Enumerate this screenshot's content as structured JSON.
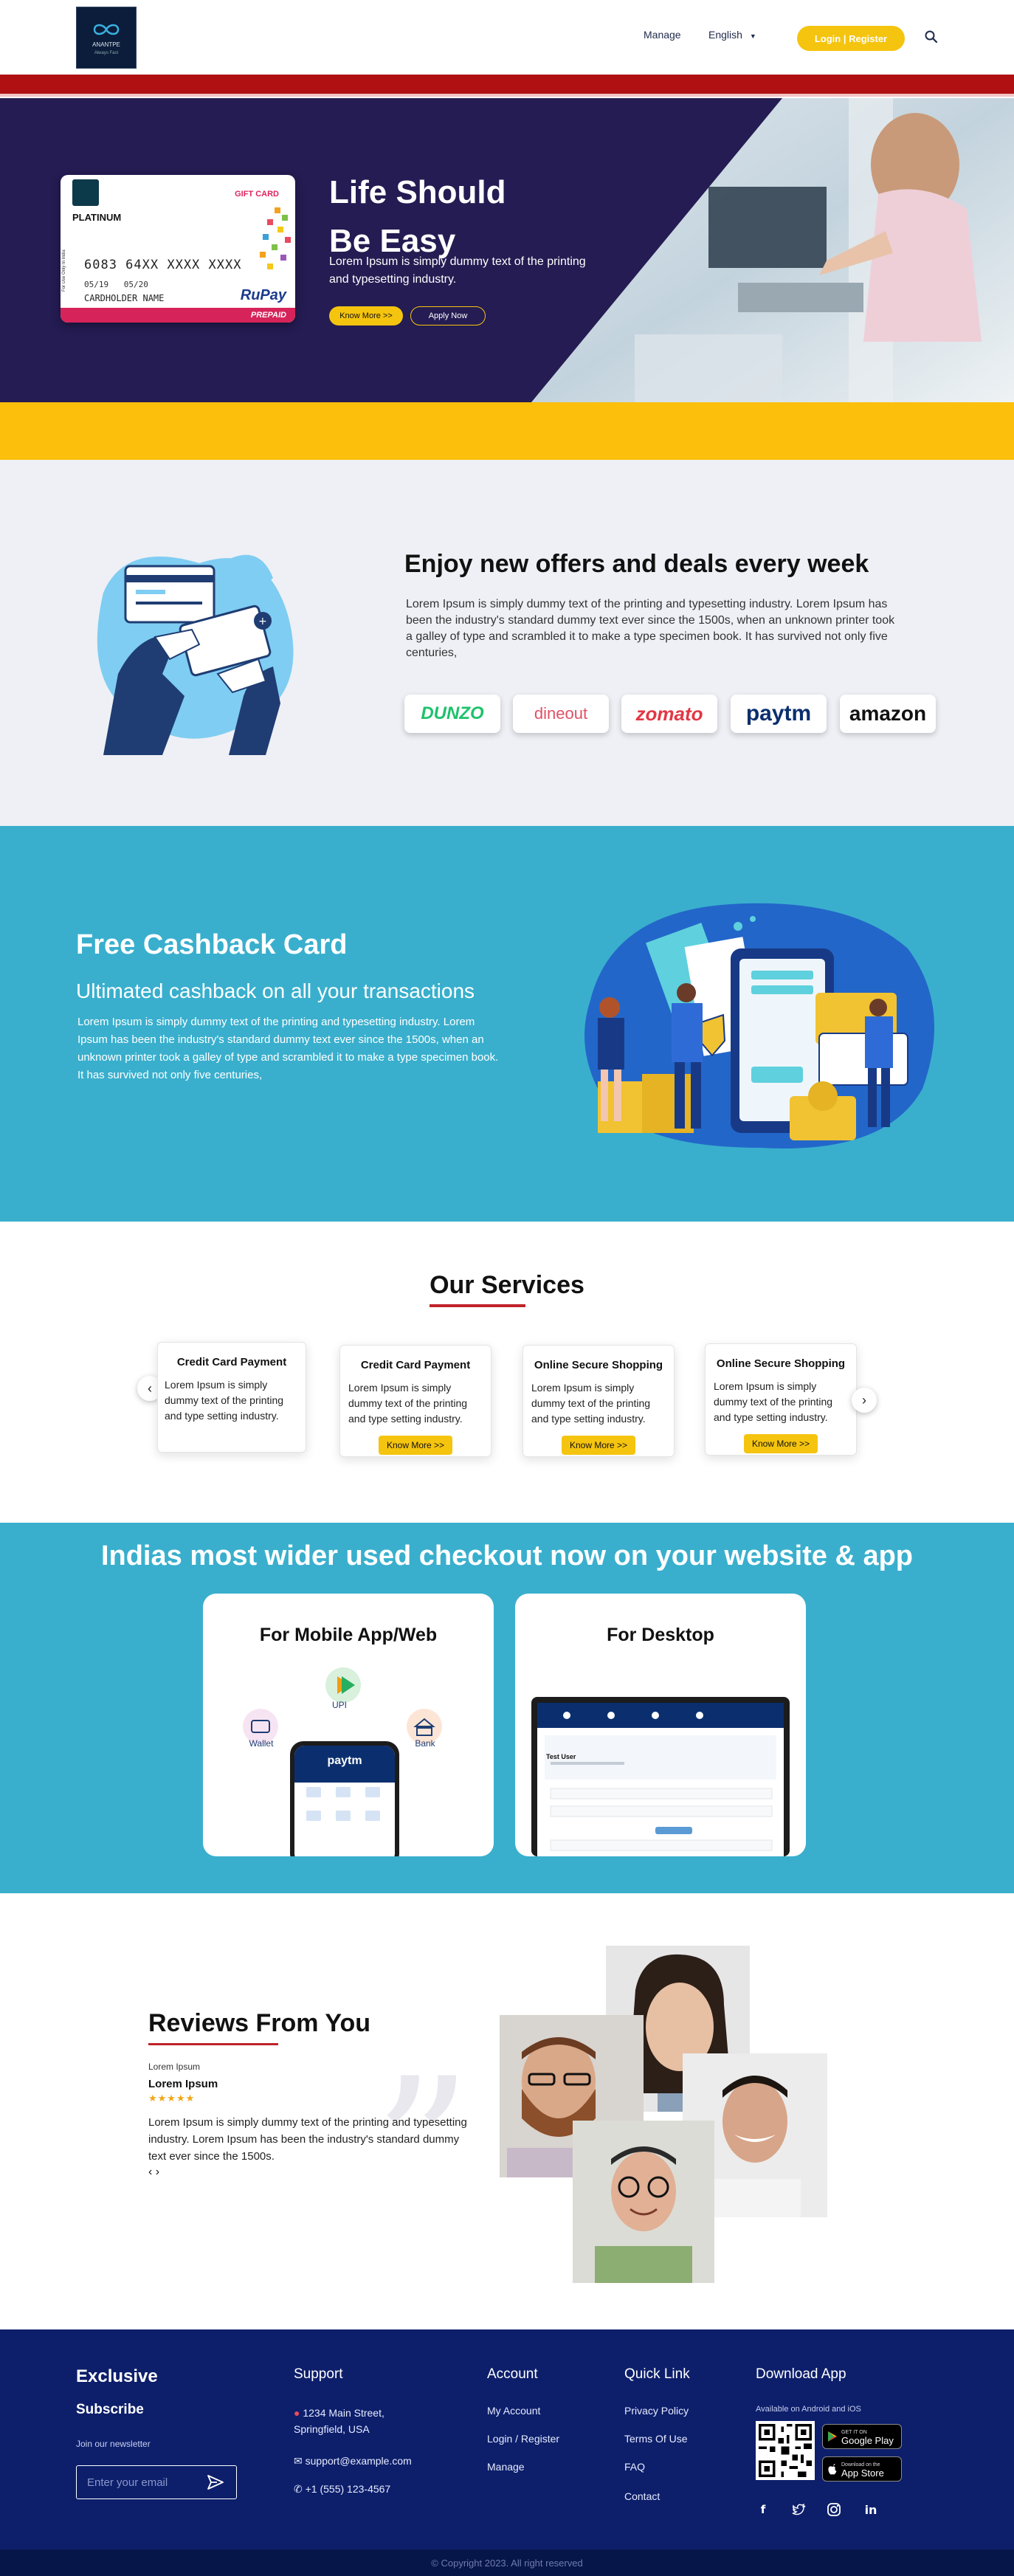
{
  "header": {
    "logo_text": "ANANTPE",
    "logo_tagline": "Always Fast",
    "nav": {
      "manage": "Manage",
      "language": "English"
    },
    "login_label": "Login | Register"
  },
  "hero": {
    "title_line1": "Life Should",
    "title_line2": "Be Easy",
    "description": "Lorem Ipsum is simply dummy text of the printing and typesetting industry.",
    "know_more": "Know More >>",
    "apply_now": "Apply Now",
    "card": {
      "tier": "PLATINUM",
      "gift": "GIFT CARD",
      "number": "6083 64XX XXXX XXXX",
      "valid_from": "05/19",
      "valid_thru": "05/20",
      "holder": "CARDHOLDER NAME",
      "network": "RuPay",
      "prepaid": "PREPAID",
      "side_text": "For Use Only In India"
    }
  },
  "offers": {
    "title": "Enjoy new offers and deals every week",
    "text": "Lorem Ipsum is simply dummy text of the printing and typesetting industry. Lorem Ipsum has been the industry's standard dummy text ever since the 1500s, when an unknown printer took a galley of type and scrambled it to make a type specimen book. It has survived not only five centuries,",
    "brands": [
      "DUNZO",
      "dineout",
      "zomato",
      "paytm",
      "amazon"
    ]
  },
  "cashback": {
    "title": "Free Cashback Card",
    "subtitle": "Ultimated cashback on all your transactions",
    "text": "Lorem Ipsum is simply dummy text of the printing and typesetting industry. Lorem Ipsum has been the industry's standard dummy text ever since the 1500s, when an unknown printer took a galley of type and scrambled it to make a type specimen book. It has survived not only five centuries,"
  },
  "services": {
    "title": "Our Services",
    "cards": [
      {
        "title": "Credit Card Payment",
        "desc": "Lorem Ipsum is simply dummy  text of the printing and type setting industry.",
        "button": ""
      },
      {
        "title": "Credit Card Payment",
        "desc": "Lorem Ipsum is simply dummy  text of the printing and type setting industry.",
        "button": "Know More >>"
      },
      {
        "title": "Online Secure Shopping",
        "desc": "Lorem Ipsum is simply dummy  text of the printing and type setting industry.",
        "button": "Know More >>"
      },
      {
        "title": "Online Secure Shopping",
        "desc": "Lorem Ipsum is simply dummy  text of the printing and type setting industry.",
        "button": "Know More >>"
      }
    ],
    "prev": "‹",
    "next": "›"
  },
  "checkout": {
    "title": "Indias most wider used checkout now on  your website & app",
    "mobile": {
      "title": "For Mobile App/Web",
      "upi": "UPI",
      "wallet": "Wallet",
      "bank": "Bank",
      "brand": "paytm"
    },
    "desktop": {
      "title": "For Desktop",
      "screen_heading": "Test User"
    }
  },
  "reviews": {
    "title": "Reviews From You",
    "small": "Lorem Ipsum",
    "name": "Lorem Ipsum",
    "stars": "★★★★★",
    "rating": 5,
    "text": "Lorem Ipsum is simply dummy text of the printing and typesetting industry. Lorem Ipsum has been the industry's standard dummy text ever since the 1500s.",
    "nav": "‹ ›"
  },
  "footer": {
    "brand": "Exclusive",
    "subscribe": "Subscribe",
    "newsletter": "Join our newsletter",
    "email_placeholder": "Enter your email",
    "support": {
      "title": "Support",
      "address_line1": "1234 Main Street,",
      "address_line2": "Springfield, USA",
      "email": "support@example.com",
      "phone": "+1 (555) 123-4567"
    },
    "account": {
      "title": "Account",
      "links": [
        "My Account",
        "Login / Register",
        "Manage"
      ]
    },
    "quick": {
      "title": "Quick Link",
      "links": [
        "Privacy Policy",
        "Terms Of Use",
        "FAQ",
        "Contact"
      ]
    },
    "download": {
      "title": "Download App",
      "sub": "Available on Android and iOS",
      "gp_small": "GET IT ON",
      "gp_large": "Google Play",
      "as_small": "Download on the",
      "as_large": "App Store"
    },
    "copyright": "© Copyright  2023. All right reserved"
  },
  "colors": {
    "accent_yellow": "#f5c40f",
    "hero_navy": "#241c52",
    "teal": "#39afcd",
    "footer_navy": "#0d1f6b",
    "red": "#b01012"
  }
}
